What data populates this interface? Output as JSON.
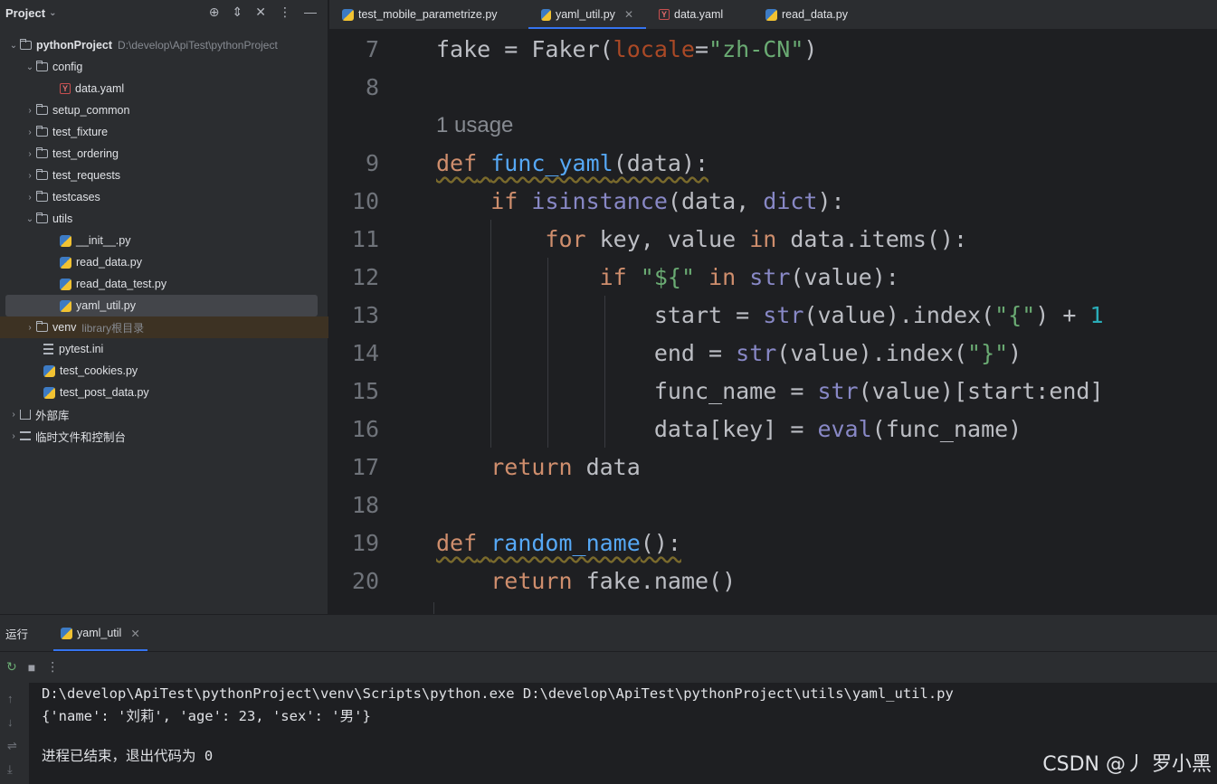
{
  "project_panel": {
    "title": "Project",
    "tree": [
      {
        "label": "pythonProject",
        "path": "D:\\develop\\ApiTest\\pythonProject"
      },
      {
        "label": "config"
      },
      {
        "label": "data.yaml"
      },
      {
        "label": "setup_common"
      },
      {
        "label": "test_fixture"
      },
      {
        "label": "test_ordering"
      },
      {
        "label": "test_requests"
      },
      {
        "label": "testcases"
      },
      {
        "label": "utils"
      },
      {
        "label": "__init__.py"
      },
      {
        "label": "read_data.py"
      },
      {
        "label": "read_data_test.py"
      },
      {
        "label": "yaml_util.py"
      },
      {
        "label": "venv",
        "note": "library根目录"
      },
      {
        "label": "pytest.ini"
      },
      {
        "label": "test_cookies.py"
      },
      {
        "label": "test_post_data.py"
      },
      {
        "label": "外部库"
      },
      {
        "label": "临时文件和控制台"
      }
    ]
  },
  "editor_tabs": [
    {
      "label": "test_mobile_parametrize.py"
    },
    {
      "label": "yaml_util.py",
      "active": true
    },
    {
      "label": "data.yaml"
    },
    {
      "label": "read_data.py"
    }
  ],
  "editor": {
    "line_numbers": [
      "7",
      "8",
      "9",
      "10",
      "11",
      "12",
      "13",
      "14",
      "15",
      "16",
      "17",
      "18",
      "19",
      "20"
    ],
    "usage_hint": "1 usage",
    "code": {
      "l7": {
        "a": "fake = Faker(",
        "b": "locale",
        "c": "=",
        "d": "\"zh-CN\"",
        "e": ")"
      },
      "l9": {
        "a": "def",
        "b": "func_yaml",
        "c": "(data):"
      },
      "l10": {
        "a": "if",
        "b": "isinstance",
        "c": "(data, ",
        "d": "dict",
        "e": "):"
      },
      "l11": {
        "a": "for",
        "b": " key, value ",
        "c": "in",
        "d": " data.items():"
      },
      "l12": {
        "a": "if",
        "b": "\"${\"",
        "c": "in",
        "d": "str",
        "e": "(value):"
      },
      "l13": {
        "a": "start = ",
        "b": "str",
        "c": "(value).index(",
        "d": "\"{\"",
        "e": ") + ",
        "f": "1"
      },
      "l14": {
        "a": "end = ",
        "b": "str",
        "c": "(value).index(",
        "d": "\"}\"",
        "e": ")"
      },
      "l15": {
        "a": "func_name = ",
        "b": "str",
        "c": "(value)[start:end]"
      },
      "l16": {
        "a": "data[key] = ",
        "b": "eval",
        "c": "(func_name)"
      },
      "l17": {
        "a": "return",
        "b": " data"
      },
      "l19": {
        "a": "def",
        "b": "random_name",
        "c": "():"
      },
      "l20": {
        "a": "return",
        "b": " fake.name()"
      }
    }
  },
  "run_panel": {
    "label": "运行",
    "tab": "yaml_util",
    "console": [
      "D:\\develop\\ApiTest\\pythonProject\\venv\\Scripts\\python.exe D:\\develop\\ApiTest\\pythonProject\\utils\\yaml_util.py",
      "{'name': '刘莉', 'age': 23, 'sex': '男'}",
      "进程已结束，退出代码为 0"
    ]
  },
  "watermark": "CSDN @丿 罗小黑"
}
